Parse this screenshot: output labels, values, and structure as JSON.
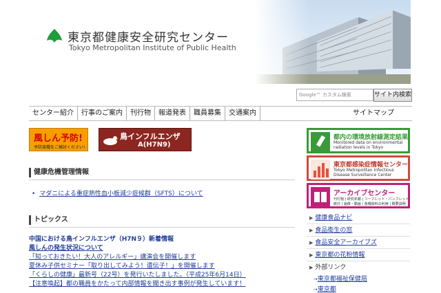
{
  "header": {
    "title": "東京都健康安全研究センター",
    "title_en": "Tokyo Metropolitan Institute of Public Health"
  },
  "search": {
    "placeholder": "Google™ カスタム検索",
    "button": "サイト内検索"
  },
  "nav": {
    "items": [
      "センター紹介",
      "行事のご案内",
      "刊行物",
      "報道発表",
      "職員募集",
      "交通案内"
    ],
    "sitemap": "サイトマップ"
  },
  "banners": {
    "influenza_title": "風しん予防!",
    "influenza_sub": "予防接種をご検討ください!",
    "bird_flu_line1": "鳥インフルエンザ",
    "bird_flu_line2": "A(H7N9)"
  },
  "health_crisis": {
    "heading": "健康危機管理情報",
    "items": [
      "マダニによる重症熱性血小板減少症候群（SFTS）について"
    ]
  },
  "topics": {
    "heading": "トピックス",
    "items": [
      "中国における鳥インフルエンザ（H7N９）新着情報",
      "風しんの発生状況について",
      "「知っておきたい！大人のアレルギー」講演会を開催します",
      "夏休み子供セミナー「取り出してみよう！遺伝子！」を開催します",
      "「くらしの健康」最新号（22号）を発行いたしました。（平成25年6月14日）",
      "【注意喚起】都の職員をかたって内部情報を聞き出す事例が発生しています！"
    ]
  },
  "sidebar": {
    "boxes": [
      {
        "title": "都内の環境放射線測定結果",
        "sub1": "Monitored data on environmental",
        "sub2": "radiation levels in Tokyo",
        "color": "#3a9a3a"
      },
      {
        "title": "東京都感染症情報センター",
        "sub1": "Tokyo Metropolitan Infectious",
        "sub2": "Disease Surveillance Center",
        "color": "#d04a3a"
      },
      {
        "title": "アーカイブセンター",
        "sub1": "刊行物 | 研究年報 | リーフレット・パンフレット",
        "sub2": "統計 | 画像・動画 | 各種資料の利用 | 概要説明",
        "color": "#c0207a"
      }
    ],
    "links": [
      "健康食品ナビ",
      "食品衛生の窓",
      "食品安全アーカイブズ",
      "東京都の花粉情報"
    ],
    "external_heading": "外部リンク",
    "external": [
      "東京都福祉保健局",
      "東京都"
    ]
  }
}
